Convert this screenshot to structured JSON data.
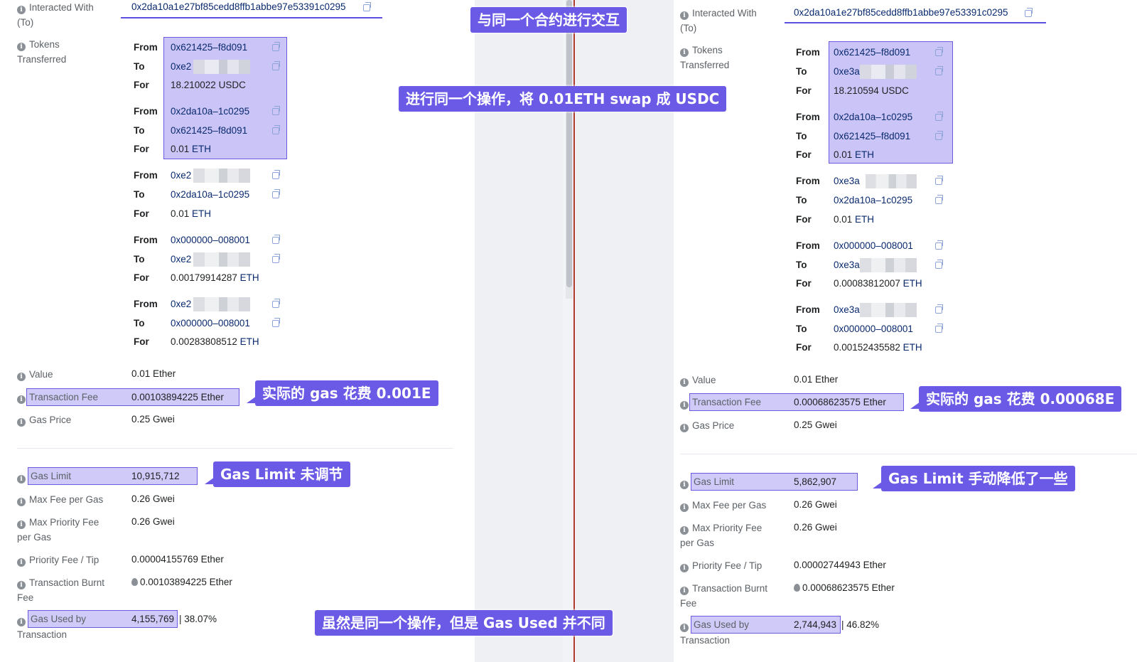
{
  "labels": {
    "interacted_with_1": "Interacted With",
    "interacted_with_2": "(To)",
    "tokens_1": "Tokens",
    "tokens_2": "Transferred",
    "value": "Value",
    "transaction_fee": "Transaction Fee",
    "gas_price": "Gas Price",
    "gas_limit": "Gas Limit",
    "max_fee": "Max Fee per Gas",
    "max_priority_1": "Max Priority Fee",
    "max_priority_2": "per Gas",
    "priority_tip": "Priority Fee / Tip",
    "burnt_1": "Transaction Burnt",
    "burnt_2": "Fee",
    "gas_used_1": "Gas Used by",
    "gas_used_2": "Transaction",
    "from": "From",
    "to": "To",
    "for": "For"
  },
  "left": {
    "contract": "0x2da10a1e27bf85cedd8ffb1abbe97e53391c0295",
    "transfers": [
      {
        "from": "0x621425–f8d091",
        "to": "0xe2",
        "for_amount": "18.210022 USDC",
        "for_unit": ""
      },
      {
        "from": "0x2da10a–1c0295",
        "to": "0x621425–f8d091",
        "for_amount": "0.01",
        "for_unit": "ETH"
      },
      {
        "from": "0xe2",
        "to": "0x2da10a–1c0295",
        "for_amount": "0.01",
        "for_unit": "ETH"
      },
      {
        "from": "0x000000–008001",
        "to": "0xe2",
        "for_amount": "0.00179914287",
        "for_unit": "ETH"
      },
      {
        "from": "0xe2",
        "to": "0x000000–008001",
        "for_amount": "0.00283808512",
        "for_unit": "ETH"
      }
    ],
    "value": "0.01 Ether",
    "transaction_fee": "0.00103894225 Ether",
    "gas_price": "0.25 Gwei",
    "gas_limit": "10,915,712",
    "max_fee": "0.26 Gwei",
    "max_priority": "0.26 Gwei",
    "priority_tip": "0.00004155769 Ether",
    "burnt": "0.00103894225 Ether",
    "gas_used": "4,155,769",
    "gas_used_pct": "| 38.07%"
  },
  "right": {
    "contract": "0x2da10a1e27bf85cedd8ffb1abbe97e53391c0295",
    "transfers": [
      {
        "from": "0x621425–f8d091",
        "to": "0xe3a",
        "for_amount": "18.210594 USDC",
        "for_unit": ""
      },
      {
        "from": "0x2da10a–1c0295",
        "to": "0x621425–f8d091",
        "for_amount": "0.01",
        "for_unit": "ETH"
      },
      {
        "from": "0xe3a",
        "to": "0x2da10a–1c0295",
        "for_amount": "0.01",
        "for_unit": "ETH"
      },
      {
        "from": "0x000000–008001",
        "to": "0xe3a",
        "for_amount": "0.00083812007",
        "for_unit": "ETH"
      },
      {
        "from": "0xe3a",
        "to": "0x000000–008001",
        "for_amount": "0.00152435582",
        "for_unit": "ETH"
      }
    ],
    "value": "0.01 Ether",
    "transaction_fee": "0.00068623575 Ether",
    "gas_price": "0.25 Gwei",
    "gas_limit": "5,862,907",
    "max_fee": "0.26 Gwei",
    "max_priority": "0.26 Gwei",
    "priority_tip": "0.00002744943 Ether",
    "burnt": "0.00068623575 Ether",
    "gas_used": "2,744,943",
    "gas_used_pct": "| 46.82%"
  },
  "callouts": {
    "same_contract": "与同一个合约进行交互",
    "same_operation": "进行同一个操作，将 0.01ETH swap 成 USDC",
    "fee_left": "实际的 gas 花费 0.001E",
    "fee_right": "实际的 gas 花费 0.00068E",
    "limit_left": "Gas Limit 未调节",
    "limit_right": "Gas Limit 手动降低了一些",
    "gas_used_diff": "虽然是同一个操作，但是 Gas Used 并不同"
  }
}
